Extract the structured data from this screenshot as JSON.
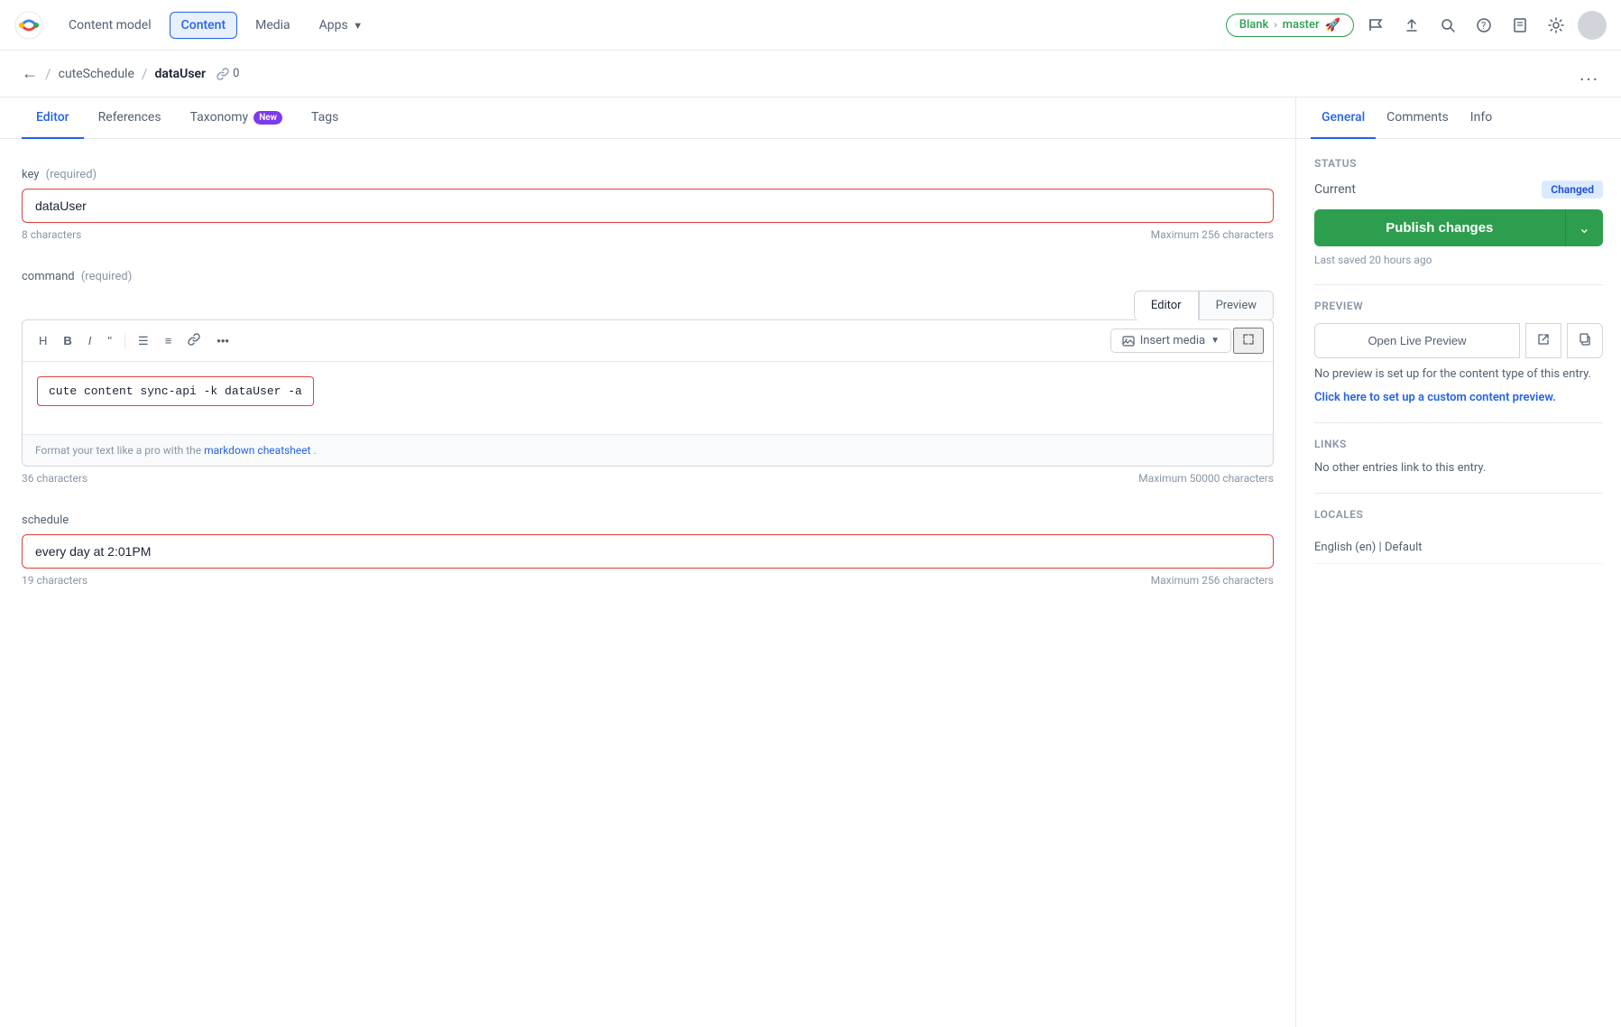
{
  "nav": {
    "content_model_label": "Content model",
    "content_label": "Content",
    "media_label": "Media",
    "apps_label": "Apps",
    "branch_from": "Blank",
    "branch_to": "master",
    "branch_icon": "🚀"
  },
  "breadcrumb": {
    "parent": "cuteSchedule",
    "current": "dataUser",
    "ref_count": "0",
    "more_label": "..."
  },
  "tabs": {
    "items": [
      {
        "label": "Editor",
        "active": true
      },
      {
        "label": "References",
        "active": false
      },
      {
        "label": "Taxonomy",
        "active": false,
        "badge": "New"
      },
      {
        "label": "Tags",
        "active": false
      }
    ]
  },
  "fields": {
    "key": {
      "label": "key",
      "required": "(required)",
      "value": "dataUser",
      "char_count": "8 characters",
      "max_chars": "Maximum 256 characters"
    },
    "command": {
      "label": "command",
      "required": "(required)",
      "editor_tab": "Editor",
      "preview_tab": "Preview",
      "toolbar": {
        "h": "H",
        "b": "B",
        "i": "I",
        "quote": "\"",
        "ul": "≡",
        "ol": "#",
        "link": "🔗",
        "more": "•••",
        "insert_media": "Insert media"
      },
      "code_value": "cute content sync-api -k dataUser -a",
      "footer_text": "Format your text like a pro with the",
      "footer_link": "markdown cheatsheet",
      "footer_link_suffix": ".",
      "char_count": "36 characters",
      "max_chars": "Maximum 50000 characters"
    },
    "schedule": {
      "label": "schedule",
      "value": "every day at 2:01PM",
      "char_count": "19 characters",
      "max_chars": "Maximum 256 characters"
    }
  },
  "right_panel": {
    "tabs": [
      {
        "label": "General",
        "active": true
      },
      {
        "label": "Comments",
        "active": false
      },
      {
        "label": "Info",
        "active": false
      }
    ],
    "status_label": "Status",
    "current_label": "Current",
    "changed_badge": "Changed",
    "publish_btn_label": "Publish changes",
    "last_saved": "Last saved 20 hours ago",
    "preview_label": "Preview",
    "open_live_preview": "Open Live Preview",
    "preview_note": "No preview is set up for the content type of this entry.",
    "custom_preview_link": "Click here to set up a custom content preview.",
    "links_label": "Links",
    "links_note": "No other entries link to this entry.",
    "locales_label": "Locales",
    "locale_value": "English (en) | Default"
  }
}
